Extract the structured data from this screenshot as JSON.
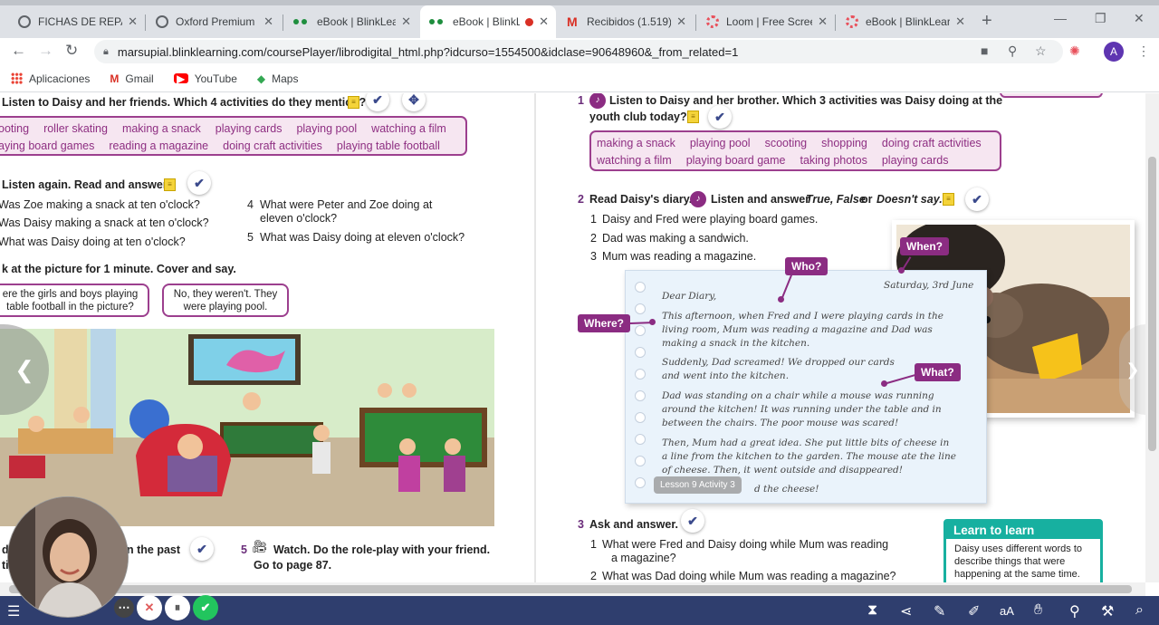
{
  "tabs": [
    {
      "title": "FICHAS DE REPASO",
      "icon": "globe-icon"
    },
    {
      "title": "Oxford Premium",
      "icon": "globe-icon"
    },
    {
      "title": "eBook | BlinkLearn",
      "icon": "blink-icon"
    },
    {
      "title": "eBook | BlinkL",
      "icon": "blink-icon",
      "active": true
    },
    {
      "title": "Recibidos (1.519) -",
      "icon": "gmail-icon"
    },
    {
      "title": "Loom | Free Screen",
      "icon": "loom-icon"
    },
    {
      "title": "eBook | BlinkLearn",
      "icon": "loom-icon"
    }
  ],
  "address": {
    "url": "marsupial.blinklearning.com/coursePlayer/librodigital_html.php?idcurso=1554500&idclase=90648960&_from_related=1"
  },
  "profile_initial": "A",
  "bookmarks": [
    {
      "label": "Aplicaciones",
      "icon": "apps-icon"
    },
    {
      "label": "Gmail",
      "icon": "gmail-icon"
    },
    {
      "label": "YouTube",
      "icon": "youtube-icon"
    },
    {
      "label": "Maps",
      "icon": "maps-icon"
    }
  ],
  "left_page": {
    "ex1_title": "Listen to Daisy and her friends. Which 4 activities do they mention?",
    "ex1_words_row1": [
      "ooting",
      "roller skating",
      "making a snack",
      "playing cards",
      "playing pool",
      "watching a film"
    ],
    "ex1_words_row2": [
      "aying board games",
      "reading a magazine",
      "doing craft activities",
      "playing table football"
    ],
    "ex2_title": "Listen again. Read and answer.",
    "ex2_q1": "Was Zoe making a snack at ten o'clock?",
    "ex2_q2": "Was Daisy making a snack at ten o'clock?",
    "ex2_q3": "What was Daisy doing at ten o'clock?",
    "ex2_q4_num": "4",
    "ex2_q4a": "What were Peter and Zoe doing at",
    "ex2_q4b": "eleven o'clock?",
    "ex2_q5_num": "5",
    "ex2_q5": "What was Daisy doing at eleven o'clock?",
    "ex3_title": "k at the picture for 1 minute. Cover and say.",
    "bubble1_a": "ere the girls and boys playing",
    "bubble1_b": "table football in the picture?",
    "bubble2_a": "No, they weren't. They",
    "bubble2_b": "were playing pool.",
    "ex4_fragment_a": "d",
    "ex4_fragment_b": "n the past",
    "ex4_fragment_c": "ti",
    "ex5_num": "5",
    "ex5_title": "Watch. Do the role-play with your friend.",
    "ex5_sub": "Go to page 87."
  },
  "right_page": {
    "ex1_num": "1",
    "ex1_title_a": "Listen to Daisy and her brother. Which 3 activities was Daisy doing at the",
    "ex1_title_b": "youth club today?",
    "ex1_words_row1": [
      "making a snack",
      "playing pool",
      "scooting",
      "shopping",
      "doing craft activities"
    ],
    "ex1_words_row2": [
      "watching a film",
      "playing board game",
      "taking photos",
      "playing cards"
    ],
    "ex2_num": "2",
    "ex2_title": "Read Daisy's diary.",
    "ex2_title_b": "Listen and answer",
    "ex2_title_c": "True, False",
    "ex2_title_d": "or",
    "ex2_title_e": "Doesn't say.",
    "ex2_items": [
      {
        "n": "1",
        "t": "Daisy and Fred were playing board games."
      },
      {
        "n": "2",
        "t": "Dad was making a sandwich."
      },
      {
        "n": "3",
        "t": "Mum was reading a magazine."
      }
    ],
    "tags": {
      "who": "Who?",
      "when": "When?",
      "where": "Where?",
      "what": "What?"
    },
    "diary_date": "Saturday, 3rd June",
    "diary_lines": [
      "Dear Diary,",
      "This afternoon, when Fred and I were playing cards in the",
      "living room, Mum was reading a magazine and Dad was",
      "making a snack in the kitchen.",
      "Suddenly, Dad screamed! We dropped our cards",
      "and went into the kitchen.",
      "Dad was standing on a chair while a mouse was running",
      "around the kitchen! It was running under the table and in",
      "between the chairs. The poor mouse was scared!",
      "Then, Mum had a great idea. She put little bits of cheese in",
      "a line from the kitchen to the garden. The mouse ate the line",
      "of cheese. Then, it went outside and disappeared!",
      "d the cheese!"
    ],
    "tooltip": "Lesson 9 Activity 3",
    "ex3_num": "3",
    "ex3_title": "Ask and answer.",
    "ex3_items": [
      {
        "n": "1",
        "t": "What were Fred and Daisy doing while Mum was reading",
        "t2": "a magazine?"
      },
      {
        "n": "2",
        "t": "What was Dad doing while Mum was reading a magazine?"
      }
    ],
    "learn_title": "Learn to learn",
    "learn_text": "Daisy uses different words to describe things that were happening at the same time."
  },
  "colors": {
    "accent": "#8b2c82",
    "teal": "#17b0a0",
    "toolbar": "#2f3e6e"
  },
  "bottom_toolbar_icons": [
    "menu-icon",
    "timer-icon",
    "share-icon",
    "pen-icon",
    "marker-icon",
    "text-size-icon",
    "hand-icon",
    "pin-icon",
    "wrench-icon",
    "magnify-icon"
  ]
}
